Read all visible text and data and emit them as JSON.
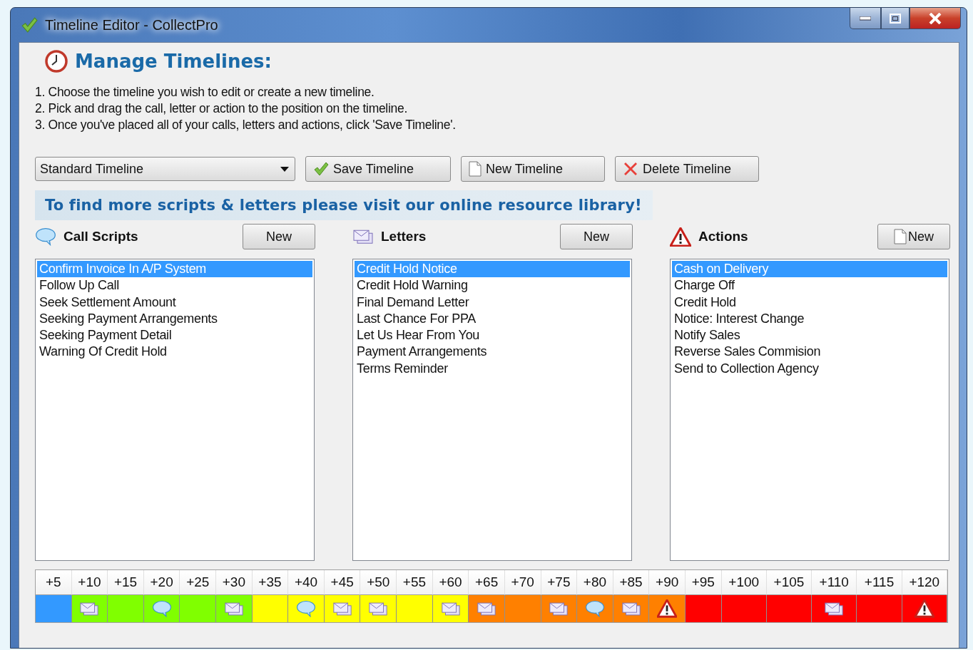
{
  "window": {
    "title": "Timeline Editor - CollectPro"
  },
  "heading": "Manage Timelines:",
  "instructions": [
    "1. Choose the timeline you wish to edit or create a new timeline.",
    "2. Pick and drag the call, letter or action to the position on the timeline.",
    "3. Once you've placed all of your calls, letters and actions, click 'Save Timeline'."
  ],
  "timeline_select": {
    "value": "Standard Timeline"
  },
  "toolbar_buttons": [
    {
      "label": "Save Timeline",
      "kind": "save"
    },
    {
      "label": "New Timeline",
      "kind": "new"
    },
    {
      "label": "Delete Timeline",
      "kind": "delete"
    }
  ],
  "banner": "To find more scripts & letters please visit our online resource library!",
  "panels": [
    {
      "title": "Call Scripts",
      "kind": "call",
      "button": {
        "label": "New",
        "kind": "plain"
      },
      "items": [
        {
          "label": "Confirm Invoice In A/P System",
          "selected": true
        },
        {
          "label": "Follow Up Call",
          "selected": false
        },
        {
          "label": "Seek Settlement Amount",
          "selected": false
        },
        {
          "label": "Seeking Payment Arrangements",
          "selected": false
        },
        {
          "label": "Seeking Payment Detail",
          "selected": false
        },
        {
          "label": "Warning Of Credit Hold",
          "selected": false
        }
      ]
    },
    {
      "title": "Letters",
      "kind": "letter",
      "button": {
        "label": "New",
        "kind": "plain"
      },
      "items": [
        {
          "label": "Credit Hold Notice",
          "selected": true
        },
        {
          "label": "Credit Hold Warning",
          "selected": false
        },
        {
          "label": "Final Demand Letter",
          "selected": false
        },
        {
          "label": "Last Chance For PPA",
          "selected": false
        },
        {
          "label": "Let Us Hear From You",
          "selected": false
        },
        {
          "label": "Payment Arrangements",
          "selected": false
        },
        {
          "label": "Terms Reminder",
          "selected": false
        }
      ]
    },
    {
      "title": "Actions",
      "kind": "action",
      "button": {
        "label": "New",
        "kind": "new"
      },
      "items": [
        {
          "label": "Cash on Delivery",
          "selected": true
        },
        {
          "label": "Charge Off",
          "selected": false
        },
        {
          "label": "Credit Hold",
          "selected": false
        },
        {
          "label": "Notice: Interest Change",
          "selected": false
        },
        {
          "label": "Notify Sales",
          "selected": false
        },
        {
          "label": "Reverse Sales Commision",
          "selected": false
        },
        {
          "label": "Send to Collection Agency",
          "selected": false
        }
      ]
    }
  ],
  "timeline": [
    {
      "label": "+5",
      "color": "#3399ff"
    },
    {
      "label": "+10",
      "color": "#80ff00",
      "kind": "letter"
    },
    {
      "label": "+15",
      "color": "#80ff00"
    },
    {
      "label": "+20",
      "color": "#80ff00",
      "kind": "call"
    },
    {
      "label": "+25",
      "color": "#80ff00"
    },
    {
      "label": "+30",
      "color": "#80ff00",
      "kind": "letter"
    },
    {
      "label": "+35",
      "color": "#ffff00"
    },
    {
      "label": "+40",
      "color": "#ffff00",
      "kind": "call"
    },
    {
      "label": "+45",
      "color": "#ffff00",
      "kind": "letter"
    },
    {
      "label": "+50",
      "color": "#ffff00",
      "kind": "letter"
    },
    {
      "label": "+55",
      "color": "#ffff00"
    },
    {
      "label": "+60",
      "color": "#ffff00",
      "kind": "letter"
    },
    {
      "label": "+65",
      "color": "#ff8000",
      "kind": "letter"
    },
    {
      "label": "+70",
      "color": "#ff8000"
    },
    {
      "label": "+75",
      "color": "#ff8000",
      "kind": "letter"
    },
    {
      "label": "+80",
      "color": "#ff8000",
      "kind": "call"
    },
    {
      "label": "+85",
      "color": "#ff8000",
      "kind": "letter"
    },
    {
      "label": "+90",
      "color": "#ff8000",
      "kind": "action"
    },
    {
      "label": "+95",
      "color": "#ff0000"
    },
    {
      "label": "+100",
      "color": "#ff0000"
    },
    {
      "label": "+105",
      "color": "#ff0000"
    },
    {
      "label": "+110",
      "color": "#ff0000",
      "kind": "letter"
    },
    {
      "label": "+115",
      "color": "#ff0000"
    },
    {
      "label": "+120",
      "color": "#ff0000",
      "kind": "action"
    }
  ]
}
